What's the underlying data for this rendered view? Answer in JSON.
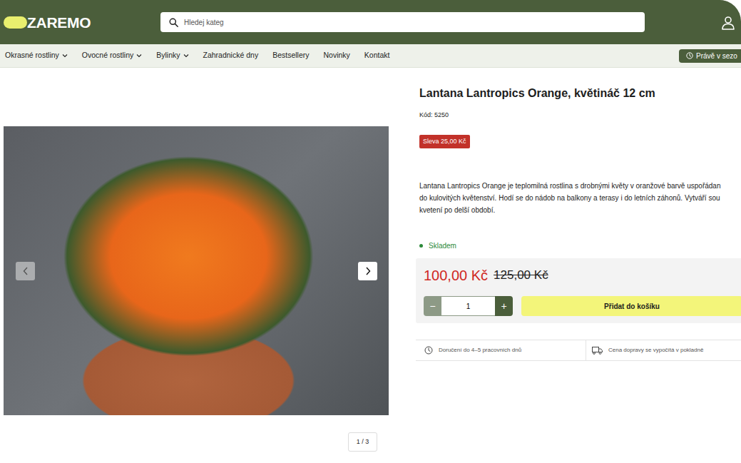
{
  "header": {
    "logo": "ZAREMO",
    "search": {
      "placeholder": "Hledej kateg"
    }
  },
  "nav": {
    "items": [
      {
        "label": "Okrasné rostliny",
        "dropdown": true
      },
      {
        "label": "Ovocné rostliny",
        "dropdown": true
      },
      {
        "label": "Bylinky",
        "dropdown": true
      },
      {
        "label": "Zahradnické dny",
        "dropdown": false
      },
      {
        "label": "Bestsellery",
        "dropdown": false
      },
      {
        "label": "Novinky",
        "dropdown": false
      },
      {
        "label": "Kontakt",
        "dropdown": false
      }
    ],
    "season_button": "Právě v sezo"
  },
  "gallery": {
    "counter": "1 / 3"
  },
  "product": {
    "title": "Lantana Lantropics Orange, květináč 12 cm",
    "code": "Kód: 5250",
    "discount_badge": "Sleva 25,00 Kč",
    "description": [
      "Lantana Lantropics Orange je teplomilná rostlina s drobnými květy v oranžové barvě uspořádan",
      "do kulovitých květenství. Hodí se do nádob na balkony a terasy i do letních záhonů. Vytváří sou",
      "kvetení po delší období."
    ],
    "stock": "Skladem",
    "price": "100,00 Kč",
    "old_price": "125,00 Kč",
    "quantity": "1",
    "quantity_minus": "−",
    "quantity_plus": "+",
    "add_to_cart": "Přidat do košíku",
    "delivery": [
      "Doručení do 4–5 pracovních dnů",
      "Cena dopravy se vypočítá v pokladně"
    ]
  }
}
